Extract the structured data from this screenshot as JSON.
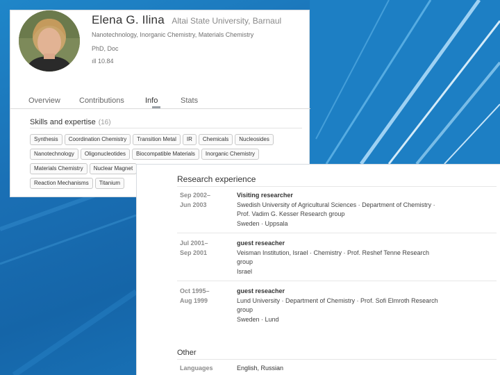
{
  "profile": {
    "name": "Elena G. Ilina",
    "affiliation": "Altai State University, Barnaul",
    "fields": "Nanotechnology, Inorganic Chemistry, Materials Chemistry",
    "degree": "PhD, Doc",
    "score": "ıll 10.84"
  },
  "tabs": [
    {
      "label": "Overview"
    },
    {
      "label": "Contributions"
    },
    {
      "label": "Info"
    },
    {
      "label": "Stats"
    }
  ],
  "skills": {
    "heading": "Skills and expertise",
    "count": "(16)",
    "rows": [
      [
        "Synthesis",
        "Coordination Chemistry",
        "Transition Metal",
        "IR",
        "Chemicals",
        "Nucleosides"
      ],
      [
        "Nanotechnology",
        "Oligonucleotides",
        "Biocompatible Materials",
        "Inorganic Chemistry"
      ],
      [
        "Materials Chemistry",
        "Nuclear Magnet"
      ],
      [
        "Reaction Mechanisms",
        "Titanium"
      ]
    ]
  },
  "research": {
    "title": "Research experience",
    "entries": [
      {
        "date1": "Sep 2002–",
        "date2": "Jun 2003",
        "role": "Visiting researcher",
        "line1": "Swedish University of Agricultural Sciences · Department of Chemistry ·",
        "line2": "Prof. Vadim G. Kesser Research group",
        "line3": "Sweden · Uppsala"
      },
      {
        "date1": "Jul 2001–",
        "date2": "Sep 2001",
        "role": "guest reseacher",
        "line1": "Veisman Institution, Israel · Chemistry · Prof. Reshef Tenne Research",
        "line2": "group",
        "line3": "Israel"
      },
      {
        "date1": "Oct 1995–",
        "date2": "Aug 1999",
        "role": "guest reseacher",
        "line1": "Lund University · Department of Chemistry · Prof. Sofi Elmroth Research",
        "line2": "group",
        "line3": "Sweden · Lund"
      }
    ]
  },
  "other": {
    "title": "Other",
    "languages_label": "Languages",
    "languages_value": "English, Russian"
  }
}
